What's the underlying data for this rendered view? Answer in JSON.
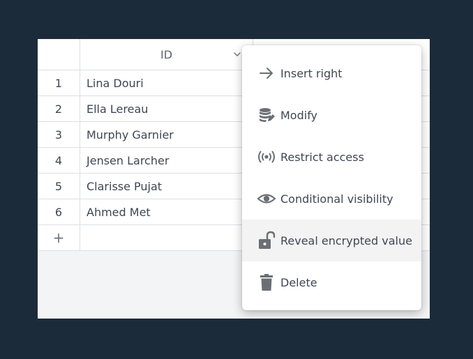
{
  "grid": {
    "header": {
      "id_label": "ID"
    },
    "rows": [
      {
        "num": "1",
        "name": "Lina Douri"
      },
      {
        "num": "2",
        "name": "Ella Lereau"
      },
      {
        "num": "3",
        "name": "Murphy Garnier"
      },
      {
        "num": "4",
        "name": "Jensen Larcher"
      },
      {
        "num": "5",
        "name": "Clarisse Pujat"
      },
      {
        "num": "6",
        "name": "Ahmed Met"
      }
    ],
    "add_row_symbol": "+"
  },
  "context_menu": {
    "items": [
      {
        "label": "Insert right",
        "icon": "arrow-right-icon"
      },
      {
        "label": "Modify",
        "icon": "database-edit-icon"
      },
      {
        "label": "Restrict access",
        "icon": "broadcast-icon"
      },
      {
        "label": "Conditional visibility",
        "icon": "eye-icon"
      },
      {
        "label": "Reveal encrypted value",
        "icon": "unlock-icon",
        "highlighted": true
      },
      {
        "label": "Delete",
        "icon": "trash-icon"
      }
    ]
  },
  "colors": {
    "background": "#1c2b3a",
    "menu_highlight": "#f3f3f3",
    "icon": "#6b6f75"
  }
}
